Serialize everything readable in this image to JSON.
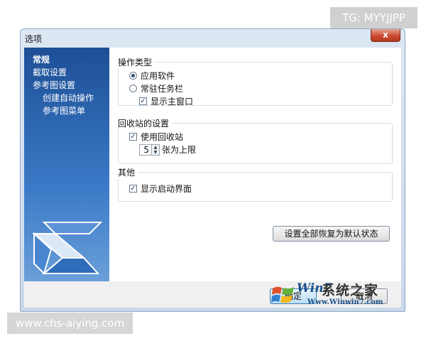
{
  "watermarks": {
    "top": "TG: MYYJJPP",
    "bottom": "www.chs-aiying.com"
  },
  "window": {
    "title": "选项",
    "close_label": "x"
  },
  "sidebar": {
    "items": [
      {
        "label": "常规",
        "active": true
      },
      {
        "label": "截取设置",
        "active": false
      },
      {
        "label": "参考图设置",
        "active": false
      },
      {
        "label": "创建自动操作",
        "active": false
      },
      {
        "label": "参考图菜单",
        "active": false
      }
    ],
    "logo_icon": "s-logo-icon"
  },
  "groups": {
    "operation_type": {
      "title": "操作类型",
      "options": [
        {
          "label": "应用软件",
          "selected": true
        },
        {
          "label": "常驻任务栏",
          "selected": false
        }
      ],
      "show_main_window": {
        "label": "显示主窗口",
        "checked": true
      }
    },
    "recycle": {
      "title": "回收站的设置",
      "use_recycle": {
        "label": "使用回收站",
        "checked": true
      },
      "limit_value": "5",
      "limit_suffix": "张为上限"
    },
    "other": {
      "title": "其他",
      "show_splash": {
        "label": "显示启动界面",
        "checked": true
      }
    }
  },
  "reset_button": "设置全部恢复为默认状态",
  "footer": {
    "ok_label": "确定",
    "cancel_label": "取消"
  },
  "brand": {
    "win": "Win7",
    "name": "系统之家",
    "url": "Www.Winwin7.com"
  },
  "colors": {
    "sidebar": "#2d66b3",
    "close_button": "#c8462c"
  }
}
